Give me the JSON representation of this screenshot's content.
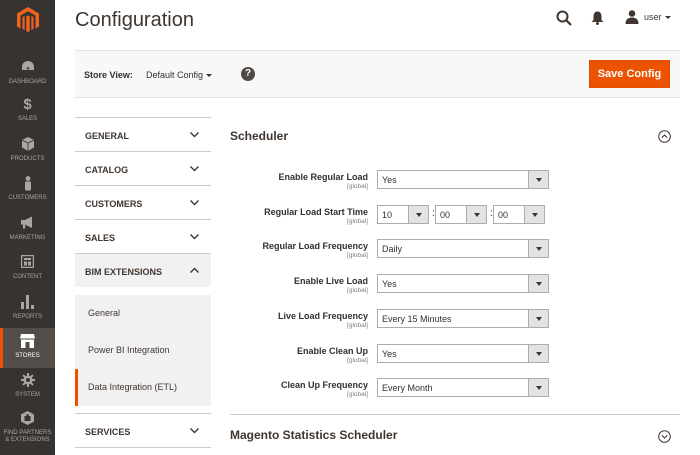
{
  "nav": {
    "items": [
      {
        "label": "DASHBOARD",
        "icon": "dashboard-icon"
      },
      {
        "label": "SALES",
        "icon": "dollar-icon"
      },
      {
        "label": "PRODUCTS",
        "icon": "cube-icon"
      },
      {
        "label": "CUSTOMERS",
        "icon": "person-icon"
      },
      {
        "label": "MARKETING",
        "icon": "megaphone-icon"
      },
      {
        "label": "CONTENT",
        "icon": "layout-icon"
      },
      {
        "label": "REPORTS",
        "icon": "bar-chart-icon"
      },
      {
        "label": "STORES",
        "icon": "store-icon"
      },
      {
        "label": "SYSTEM",
        "icon": "gear-icon"
      },
      {
        "label": "FIND PARTNERS & EXTENSIONS",
        "icon": "extensions-icon"
      }
    ],
    "active_index": 7,
    "accent_color": "#eb5202"
  },
  "header": {
    "title": "Configuration",
    "user_name": "user"
  },
  "store_view": {
    "label": "Store View:",
    "value": "Default Config",
    "save_label": "Save Config"
  },
  "tabs": {
    "general": "GENERAL",
    "catalog": "CATALOG",
    "customers": "CUSTOMERS",
    "sales": "SALES",
    "bim": "BIM EXTENSIONS",
    "bim_items": [
      "General",
      "Power BI Integration",
      "Data Integration (ETL)"
    ],
    "services": "SERVICES"
  },
  "scheduler": {
    "title": "Scheduler",
    "scope": "[global]",
    "fields": {
      "enable_regular": {
        "label": "Enable Regular Load",
        "value": "Yes"
      },
      "start_time": {
        "label": "Regular Load Start Time",
        "hour": "10",
        "minute": "00",
        "second": "00"
      },
      "regular_freq": {
        "label": "Regular Load Frequency",
        "value": "Daily"
      },
      "enable_live": {
        "label": "Enable Live Load",
        "value": "Yes"
      },
      "live_freq": {
        "label": "Live Load Frequency",
        "value": "Every 15 Minutes"
      },
      "enable_cleanup": {
        "label": "Enable Clean Up",
        "value": "Yes"
      },
      "cleanup_freq": {
        "label": "Clean Up Frequency",
        "value": "Every Month"
      }
    }
  },
  "stats_scheduler": {
    "title": "Magento Statistics Scheduler"
  }
}
